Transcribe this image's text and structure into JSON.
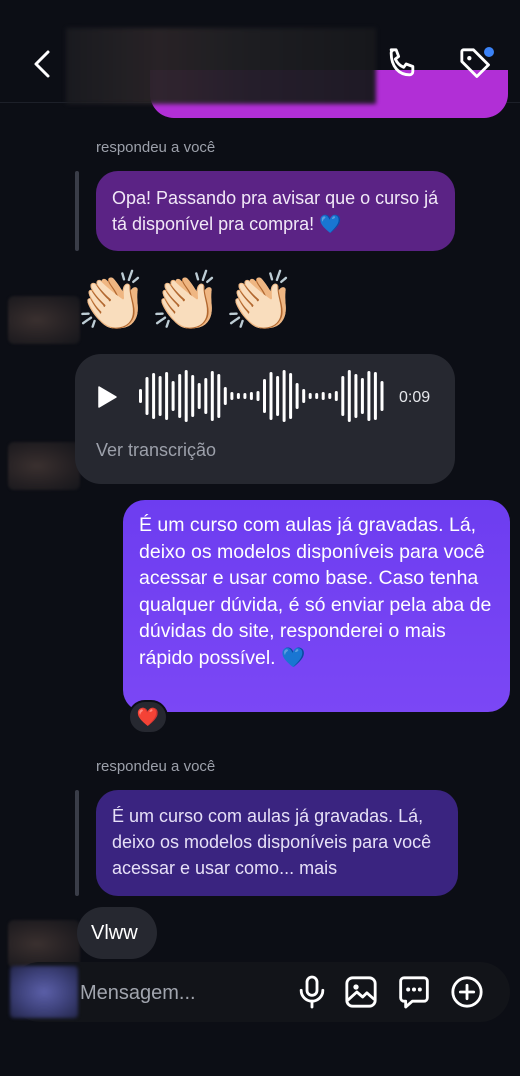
{
  "header": {
    "back_icon": "chevron-left-icon",
    "call_icon": "phone-icon",
    "tag_icon": "tag-icon",
    "notification_color": "#3b82f6"
  },
  "messages": {
    "reply1": {
      "label": "respondeu a você",
      "text": "Opa! Passando pra avisar que o curso já tá disponível pra compra! 💙"
    },
    "emoji": "👏🏻👏🏻👏🏻",
    "audio": {
      "duration": "0:09",
      "transcript_link": "Ver transcrição"
    },
    "outgoing": {
      "text": "É um curso com aulas já gravadas. Lá, deixo os modelos disponíveis para você acessar e usar como base. Caso tenha qualquer dúvida, é só enviar pela aba de dúvidas do site, responderei o mais rápido possível. 💙",
      "reaction": "❤️"
    },
    "reply2": {
      "label": "respondeu a você",
      "text": "É um curso com aulas já gravadas. Lá, deixo os modelos disponíveis para você acessar e usar como... mais"
    },
    "last": {
      "text": "Vlww"
    }
  },
  "composer": {
    "placeholder": "Mensagem...",
    "icons": [
      "microphone-icon",
      "image-icon",
      "sticker-icon",
      "plus-icon"
    ]
  },
  "colors": {
    "background": "#0c0e15",
    "outgoing_bubble": "#7b47f5",
    "reply1_bubble": "#5b2385",
    "reply2_bubble": "#3a2480",
    "incoming_bubble": "#262830"
  }
}
